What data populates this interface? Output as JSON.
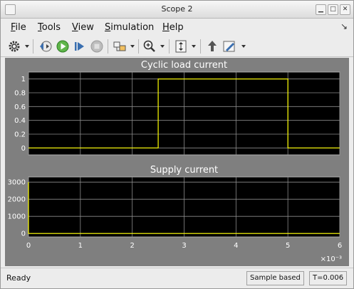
{
  "window": {
    "title": "Scope 2"
  },
  "menu": {
    "file": {
      "first": "F",
      "rest": "ile"
    },
    "tools": {
      "first": "T",
      "rest": "ools"
    },
    "view": {
      "first": "V",
      "rest": "iew"
    },
    "simulation": {
      "first": "S",
      "rest": "imulation"
    },
    "help": {
      "first": "H",
      "rest": "elp"
    }
  },
  "toolbar": {
    "icons": [
      "gear-icon",
      "step-back-icon",
      "run-icon",
      "step-forward-icon",
      "stop-icon",
      "signal-selector-icon",
      "zoom-in-icon",
      "autoscale-icon",
      "highlight-simulink-block-icon",
      "style-brush-icon"
    ]
  },
  "status": {
    "text": "Ready",
    "sample_mode": "Sample based",
    "time": "T=0.006"
  },
  "chart_data": [
    {
      "type": "line",
      "title": "Cyclic load current",
      "x": [
        0,
        0.0025,
        0.0025,
        0.005,
        0.005,
        0.006
      ],
      "y": [
        0,
        0,
        1,
        1,
        0,
        0
      ],
      "xlim": [
        0,
        6
      ],
      "xscale_label": "×10⁻³",
      "ylim": [
        -0.1,
        1.1
      ],
      "yticks": [
        0,
        0.2,
        0.4,
        0.6,
        0.8,
        1
      ],
      "xticks": [
        0,
        1,
        2,
        3,
        4,
        5,
        6
      ],
      "grid": true,
      "line_color": "#ffff00",
      "background": "#000000"
    },
    {
      "type": "line",
      "title": "Supply current",
      "x": [
        0,
        0,
        0.006
      ],
      "y": [
        3000,
        0,
        0
      ],
      "xlim": [
        0,
        6
      ],
      "xscale_label": "×10⁻³",
      "ylim": [
        -200,
        3300
      ],
      "yticks": [
        0,
        1000,
        2000,
        3000
      ],
      "xticks": [
        0,
        1,
        2,
        3,
        4,
        5,
        6
      ],
      "xticklabels": [
        "0",
        "1",
        "2",
        "3",
        "4",
        "5",
        "6"
      ],
      "grid": true,
      "line_color": "#ffff00",
      "background": "#000000"
    }
  ]
}
